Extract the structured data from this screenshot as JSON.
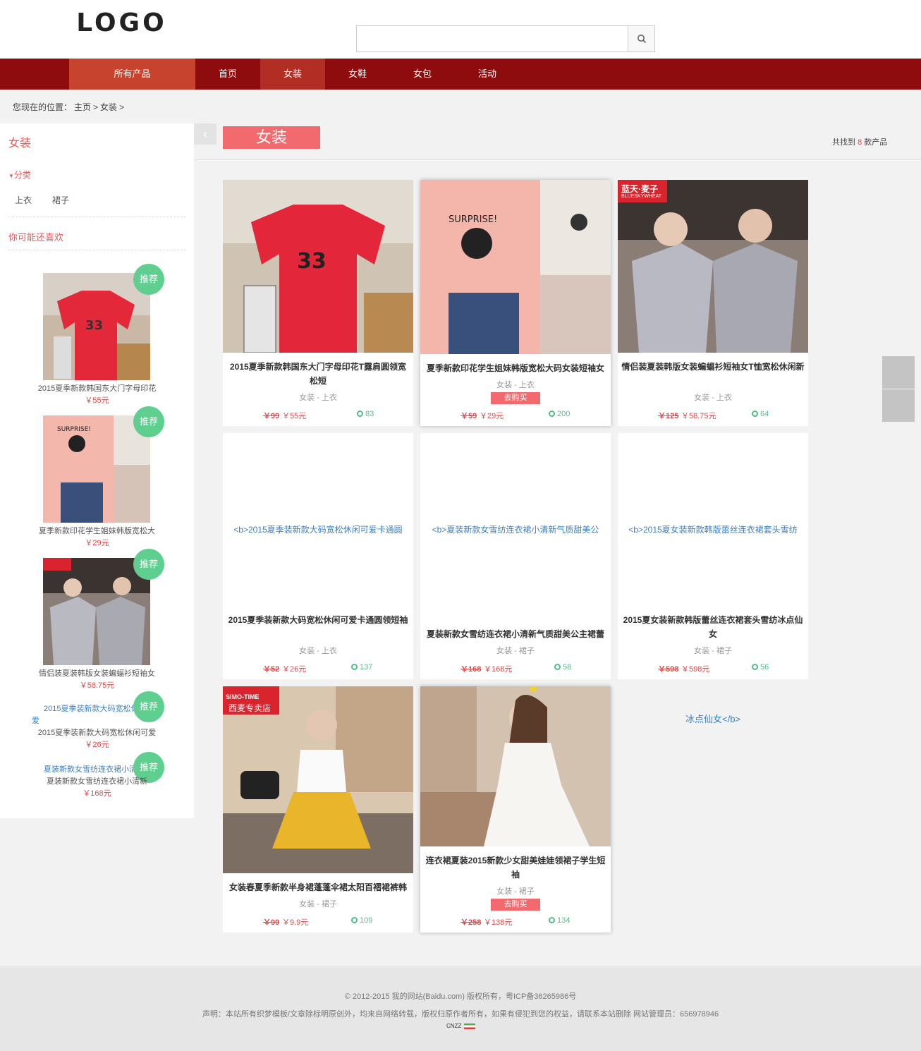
{
  "header": {
    "logo": "LOGO",
    "search_placeholder": ""
  },
  "nav": {
    "all_products": "所有产品",
    "items": [
      "首页",
      "女装",
      "女鞋",
      "女包",
      "活动"
    ],
    "active": "女装"
  },
  "breadcrumb": {
    "prefix": "您现在的位置：",
    "home": "主页",
    "sep1": ">",
    "current": "女装",
    "sep2": ">"
  },
  "sidebar": {
    "title": "女装",
    "category_label": "分类",
    "categories": [
      "上衣",
      "裙子"
    ],
    "you_may_like": "你可能还喜欢",
    "badge": "推荐",
    "items": [
      {
        "name": "2015夏季新款韩国东大门字母印花",
        "price": "￥55元"
      },
      {
        "name": "夏季新款印花学生姐妹韩版宽松大",
        "price": "￥29元"
      },
      {
        "name": "情侣装夏装韩版女装蝙蝠衫短袖女",
        "price": "￥58.75元"
      },
      {
        "link": "2015夏季装新款大码宽松休闲可",
        "link2": "爱",
        "name": "2015夏季装新款大码宽松休闲可爱",
        "price": "￥26元"
      },
      {
        "link": "夏装新款女雪纺连衣裙小清新",
        "name": "夏装新款女雪纺连衣裙小清新",
        "price": "￥168元"
      }
    ]
  },
  "main": {
    "category_tag": "女装",
    "count_prefix": "共找到",
    "count": "8",
    "count_suffix": "款产品",
    "products": [
      {
        "title": "2015夏季新款韩国东大门字母印花T露肩圆领宽松短",
        "meta": "女装 - 上衣",
        "old_price": "￥99",
        "price": "￥55元",
        "views": "83"
      },
      {
        "title": "夏季新款印花学生姐妹韩版宽松大码女装短袖女",
        "meta": "女装 - 上衣",
        "buy": "去购买",
        "old_price": "￥59",
        "price": "￥29元",
        "views": "200"
      },
      {
        "title": "情侣装夏装韩版女装蝙蝠衫短袖女T恤宽松休闲新",
        "meta": "女装 - 上衣",
        "old_price": "￥125",
        "price": "￥58.75元",
        "views": "64"
      },
      {
        "alt": "<b>2015夏季装新款大码宽松休闲可爱卡通圆",
        "title": "2015夏季装新款大码宽松休闲可爱卡通圆领短袖",
        "meta": "女装 - 上衣",
        "old_price": "￥52",
        "price": "￥26元",
        "views": "137"
      },
      {
        "alt": "<b>夏装新款女雪纺连衣裙小清新气质甜美公",
        "title": "夏装新款女雪纺连衣裙小清新气质甜美公主裙蕾",
        "meta": "女装 - 裙子",
        "old_price": "￥168",
        "price": "￥168元",
        "views": "58"
      },
      {
        "alt": "<b>2015夏女装新款韩版蕾丝连衣裙套头雪纺",
        "title": "2015夏女装新款韩版蕾丝连衣裙套头雪纺冰点仙女",
        "meta": "女装 - 裙子",
        "old_price": "￥598",
        "price": "￥598元",
        "views": "56"
      },
      {
        "title": "女装春夏季新款半身裙蓬蓬伞裙太阳百褶裙裤韩",
        "meta": "女装 - 裙子",
        "old_price": "￥99",
        "price": "￥9.9元",
        "views": "109"
      },
      {
        "title": "连衣裙夏装2015新款少女甜美娃娃领裙子学生短袖",
        "meta": "女装 - 裙子",
        "buy": "去购买",
        "old_price": "￥258",
        "price": "￥138元",
        "views": "134"
      }
    ],
    "overflow_text": "冰点仙女</b>",
    "shop_badge_1": "蓝天·麦子",
    "shop_badge_1_sub": "BLUESKYWHEAT",
    "shop_badge_2": "SIMO-TIME",
    "shop_badge_2_sub": "西麦专卖店"
  },
  "footer": {
    "copyright": "© 2012-2015 我的网站(Baidu.com) 版权所有，粤ICP备36265986号",
    "statement": "声明：本站所有织梦模板/文章除标明原创外，均来自网络转载，版权归原作者所有，如果有侵犯到您的权益，请联系本站删除 网站管理员：656978946",
    "cnzz": "CNZZ"
  },
  "colors": {
    "nav": "#8e0c0e",
    "accent": "#f26a6e",
    "badge": "#5fcf8f",
    "price": "#e24a4a"
  }
}
